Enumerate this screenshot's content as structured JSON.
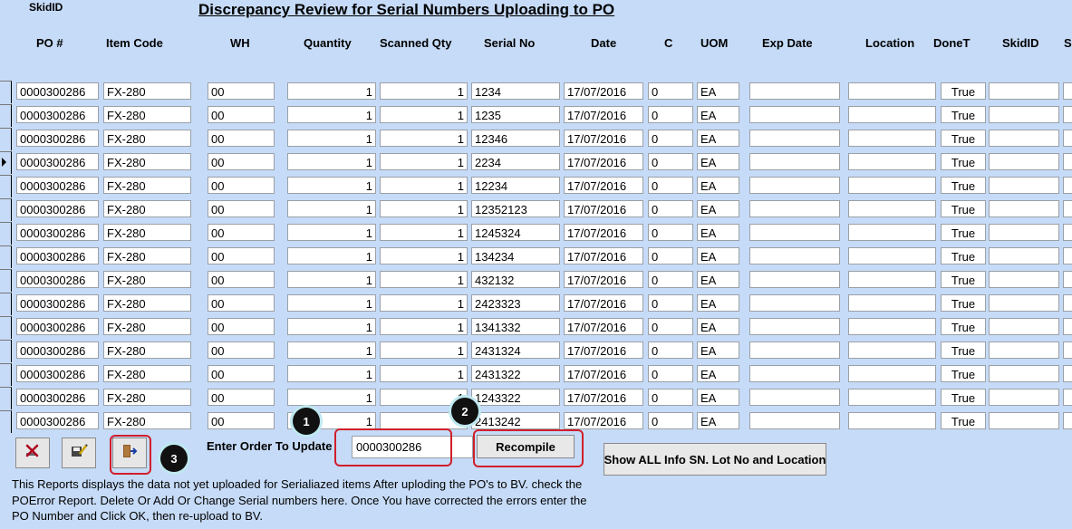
{
  "form": {
    "title": "Discrepancy Review for Serial Numbers Uploading to PO",
    "skid_label": "SkidID"
  },
  "columns": [
    {
      "label": "PO #"
    },
    {
      "label": "Item Code"
    },
    {
      "label": "WH"
    },
    {
      "label": "Quantity"
    },
    {
      "label": "Scanned Qty"
    },
    {
      "label": "Serial No"
    },
    {
      "label": "Date"
    },
    {
      "label": "C"
    },
    {
      "label": "UOM"
    },
    {
      "label": "Exp Date"
    },
    {
      "label": "Location"
    },
    {
      "label": "DoneT"
    },
    {
      "label": "SkidID"
    },
    {
      "label": "Sc"
    }
  ],
  "rows": [
    {
      "po": "0000300286",
      "item": "FX-280",
      "wh": "00",
      "qty": "1",
      "scanned": "1",
      "serial": "1234",
      "date": "17/07/2016",
      "c": "0",
      "uom": "EA",
      "exp": "",
      "loc": "",
      "done": "True",
      "skid": ""
    },
    {
      "po": "0000300286",
      "item": "FX-280",
      "wh": "00",
      "qty": "1",
      "scanned": "1",
      "serial": "1235",
      "date": "17/07/2016",
      "c": "0",
      "uom": "EA",
      "exp": "",
      "loc": "",
      "done": "True",
      "skid": ""
    },
    {
      "po": "0000300286",
      "item": "FX-280",
      "wh": "00",
      "qty": "1",
      "scanned": "1",
      "serial": "12346",
      "date": "17/07/2016",
      "c": "0",
      "uom": "EA",
      "exp": "",
      "loc": "",
      "done": "True",
      "skid": ""
    },
    {
      "po": "0000300286",
      "item": "FX-280",
      "wh": "00",
      "qty": "1",
      "scanned": "1",
      "serial": "2234",
      "date": "17/07/2016",
      "c": "0",
      "uom": "EA",
      "exp": "",
      "loc": "",
      "done": "True",
      "skid": "",
      "current": true
    },
    {
      "po": "0000300286",
      "item": "FX-280",
      "wh": "00",
      "qty": "1",
      "scanned": "1",
      "serial": "12234",
      "date": "17/07/2016",
      "c": "0",
      "uom": "EA",
      "exp": "",
      "loc": "",
      "done": "True",
      "skid": ""
    },
    {
      "po": "0000300286",
      "item": "FX-280",
      "wh": "00",
      "qty": "1",
      "scanned": "1",
      "serial": "12352123",
      "date": "17/07/2016",
      "c": "0",
      "uom": "EA",
      "exp": "",
      "loc": "",
      "done": "True",
      "skid": ""
    },
    {
      "po": "0000300286",
      "item": "FX-280",
      "wh": "00",
      "qty": "1",
      "scanned": "1",
      "serial": "1245324",
      "date": "17/07/2016",
      "c": "0",
      "uom": "EA",
      "exp": "",
      "loc": "",
      "done": "True",
      "skid": ""
    },
    {
      "po": "0000300286",
      "item": "FX-280",
      "wh": "00",
      "qty": "1",
      "scanned": "1",
      "serial": "134234",
      "date": "17/07/2016",
      "c": "0",
      "uom": "EA",
      "exp": "",
      "loc": "",
      "done": "True",
      "skid": ""
    },
    {
      "po": "0000300286",
      "item": "FX-280",
      "wh": "00",
      "qty": "1",
      "scanned": "1",
      "serial": "432132",
      "date": "17/07/2016",
      "c": "0",
      "uom": "EA",
      "exp": "",
      "loc": "",
      "done": "True",
      "skid": ""
    },
    {
      "po": "0000300286",
      "item": "FX-280",
      "wh": "00",
      "qty": "1",
      "scanned": "1",
      "serial": "2423323",
      "date": "17/07/2016",
      "c": "0",
      "uom": "EA",
      "exp": "",
      "loc": "",
      "done": "True",
      "skid": ""
    },
    {
      "po": "0000300286",
      "item": "FX-280",
      "wh": "00",
      "qty": "1",
      "scanned": "1",
      "serial": "1341332",
      "date": "17/07/2016",
      "c": "0",
      "uom": "EA",
      "exp": "",
      "loc": "",
      "done": "True",
      "skid": ""
    },
    {
      "po": "0000300286",
      "item": "FX-280",
      "wh": "00",
      "qty": "1",
      "scanned": "1",
      "serial": "2431324",
      "date": "17/07/2016",
      "c": "0",
      "uom": "EA",
      "exp": "",
      "loc": "",
      "done": "True",
      "skid": ""
    },
    {
      "po": "0000300286",
      "item": "FX-280",
      "wh": "00",
      "qty": "1",
      "scanned": "1",
      "serial": "2431322",
      "date": "17/07/2016",
      "c": "0",
      "uom": "EA",
      "exp": "",
      "loc": "",
      "done": "True",
      "skid": ""
    },
    {
      "po": "0000300286",
      "item": "FX-280",
      "wh": "00",
      "qty": "1",
      "scanned": "1",
      "serial": "1243322",
      "date": "17/07/2016",
      "c": "0",
      "uom": "EA",
      "exp": "",
      "loc": "",
      "done": "True",
      "skid": ""
    },
    {
      "po": "0000300286",
      "item": "FX-280",
      "wh": "00",
      "qty": "1",
      "scanned": "1",
      "serial": "2413242",
      "date": "17/07/2016",
      "c": "0",
      "uom": "EA",
      "exp": "",
      "loc": "",
      "done": "True",
      "skid": ""
    }
  ],
  "footer": {
    "enter_order_label": "Enter Order To Update",
    "order_value": "0000300286",
    "recompile_label": "Recompile",
    "show_all_label": "Show ALL Info SN. Lot No and Location",
    "description": "This Reports displays the data not yet uploaded for Serialiazed items After uploding the PO's to BV. check the POError Report. Delete Or Add Or Change Serial numbers here. Once You have corrected the errors enter  the PO Number and Click OK, then re-upload to BV.",
    "icons": [
      "delete-icon",
      "edit-save-icon",
      "exit-door-icon"
    ]
  },
  "callouts": [
    "1",
    "2",
    "3"
  ],
  "colors": {
    "background": "#c6dbf7",
    "callout_bg": "#111111",
    "highlight_red": "#d01f2b"
  }
}
